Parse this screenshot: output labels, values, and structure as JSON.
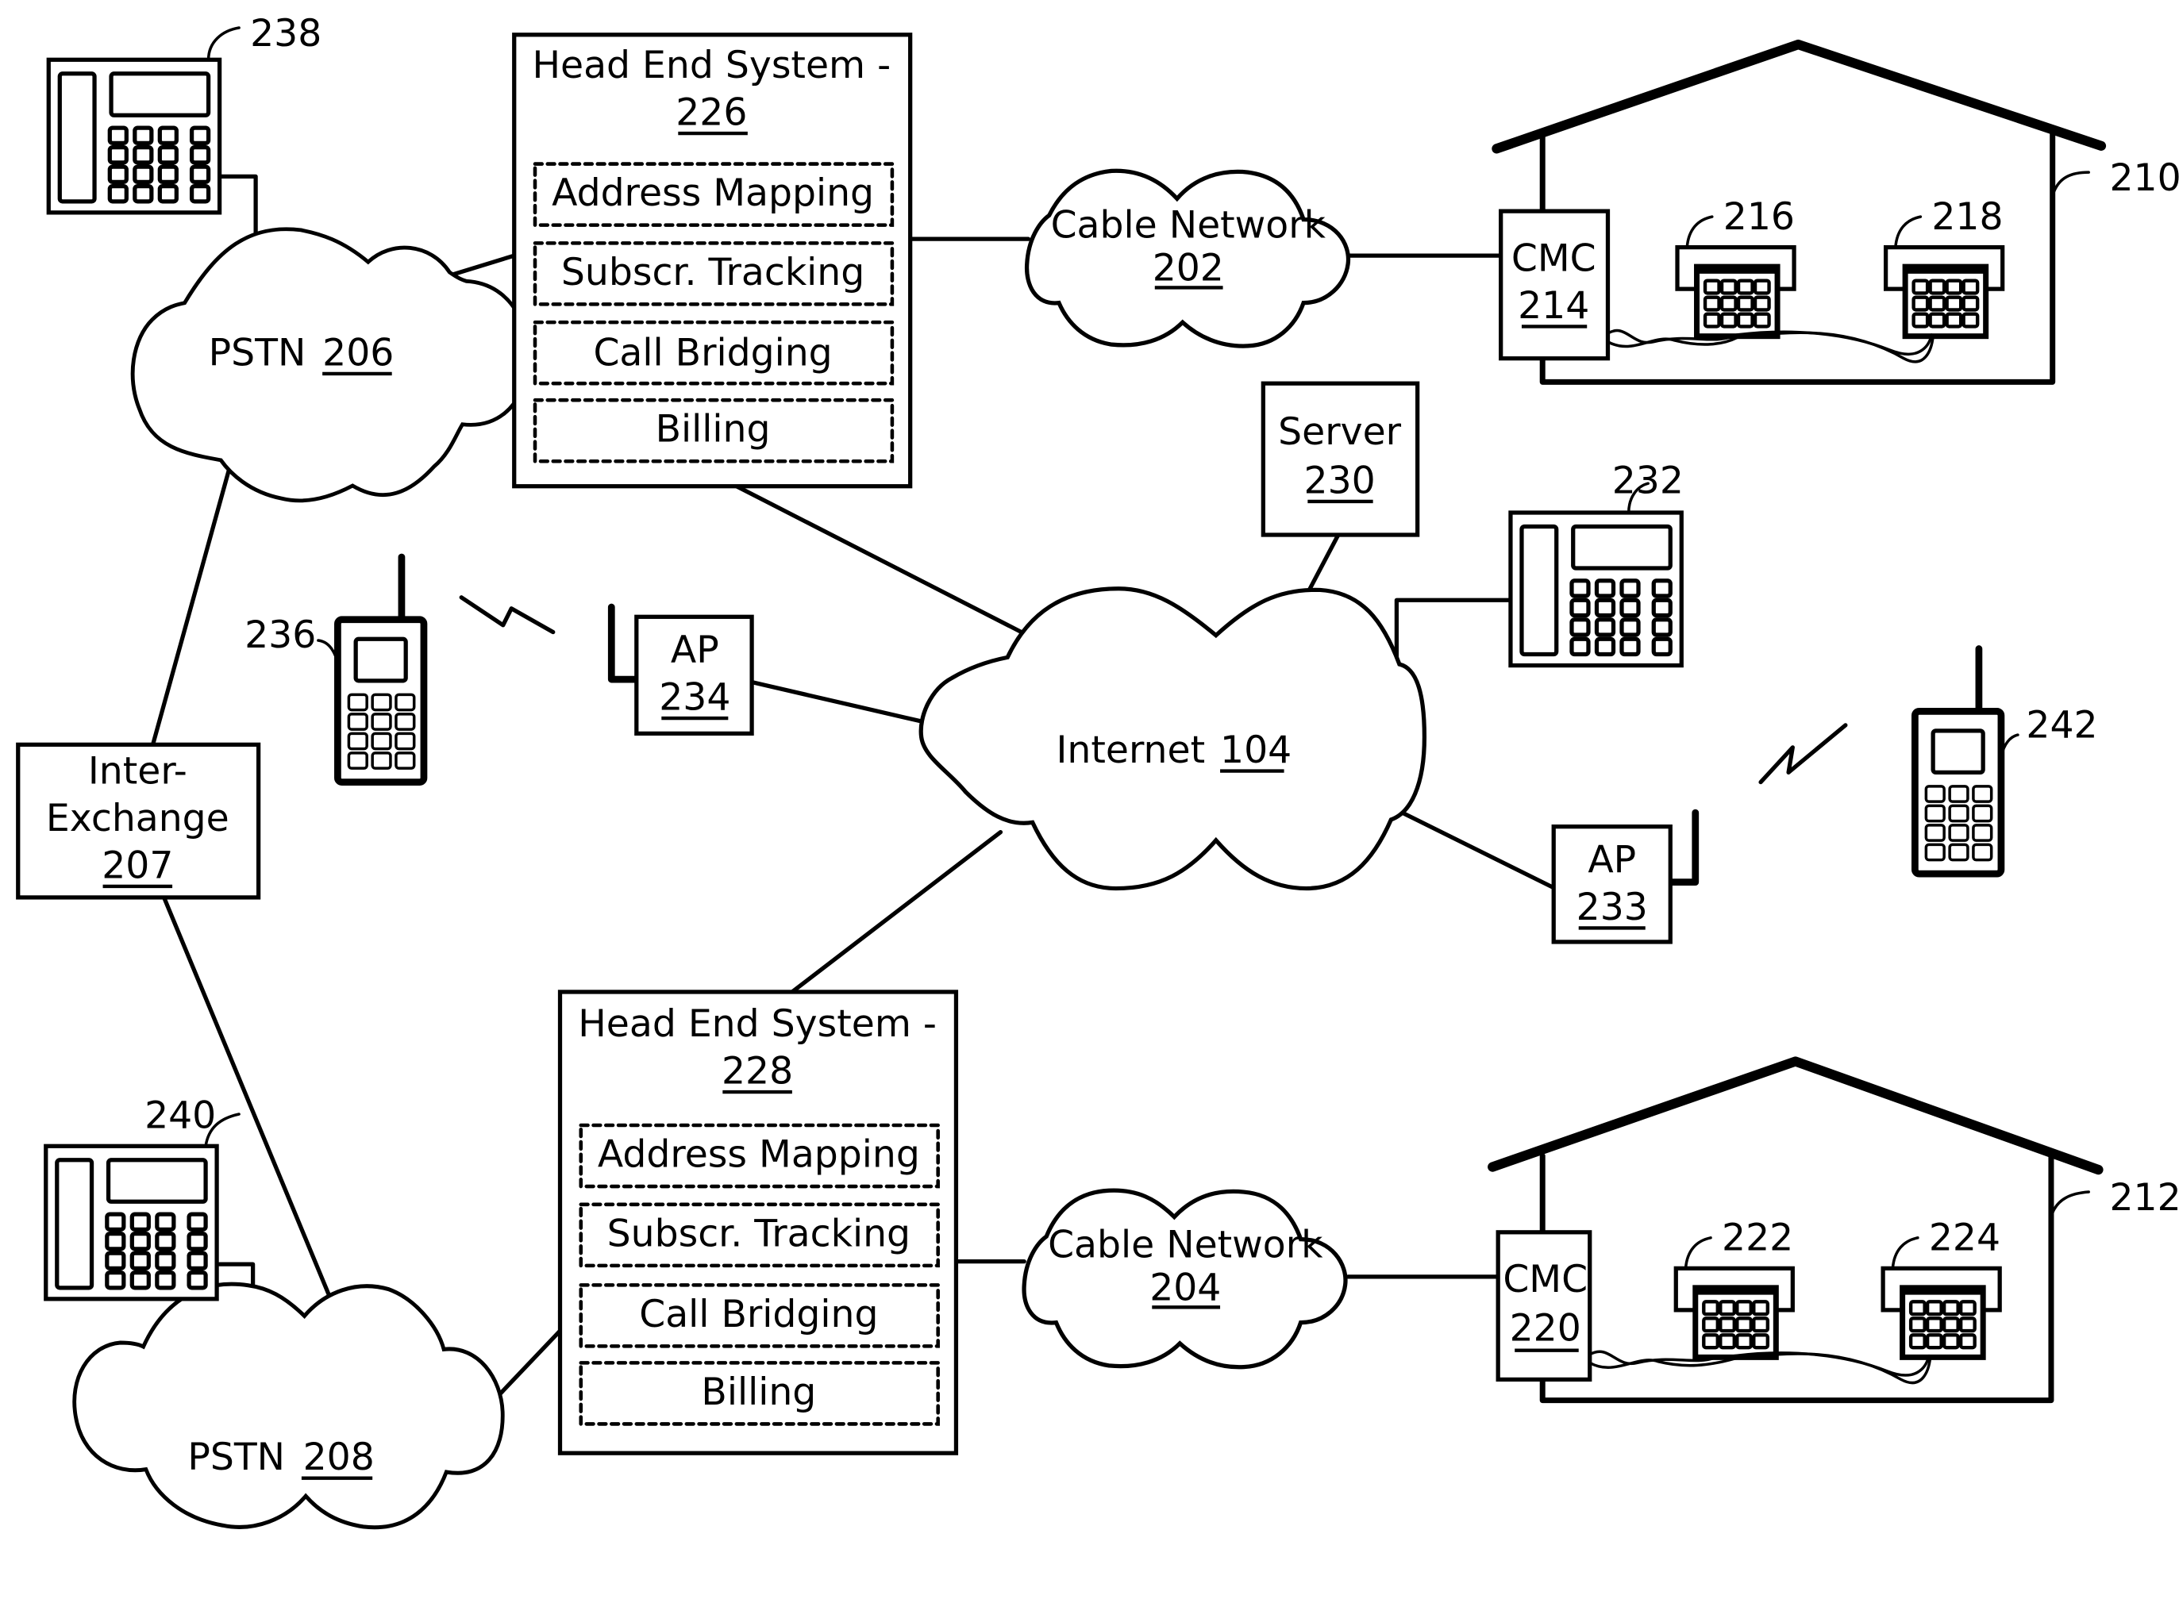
{
  "figure": {
    "head_end_226": {
      "title": "Head End System -",
      "ref": "226",
      "modules": [
        "Address Mapping",
        "Subscr. Tracking",
        "Call Bridging",
        "Billing"
      ]
    },
    "head_end_228": {
      "title": "Head End System -",
      "ref": "228",
      "modules": [
        "Address Mapping",
        "Subscr. Tracking",
        "Call Bridging",
        "Billing"
      ]
    },
    "cable_network_202": {
      "label": "Cable Network",
      "ref": "202"
    },
    "cable_network_204": {
      "label": "Cable Network",
      "ref": "204"
    },
    "pstn_206": {
      "label": "PSTN",
      "ref": "206"
    },
    "pstn_208": {
      "label": "PSTN",
      "ref": "208"
    },
    "internet": {
      "label": "Internet",
      "ref": "104"
    },
    "inter_exchange": {
      "line1": "Inter-",
      "line2": "Exchange",
      "ref": "207"
    },
    "server": {
      "label": "Server",
      "ref": "230"
    },
    "ap_234": {
      "label": "AP",
      "ref": "234"
    },
    "ap_233": {
      "label": "AP",
      "ref": "233"
    },
    "cmc_214": {
      "label": "CMC",
      "ref": "214"
    },
    "cmc_220": {
      "label": "CMC",
      "ref": "220"
    },
    "house_210": {
      "ref": "210"
    },
    "house_212": {
      "ref": "212"
    },
    "phones": {
      "desk_238": "238",
      "desk_240": "240",
      "desk_232": "232",
      "mobile_236": "236",
      "mobile_242": "242",
      "home_216": "216",
      "home_218": "218",
      "home_222": "222",
      "home_224": "224"
    }
  }
}
